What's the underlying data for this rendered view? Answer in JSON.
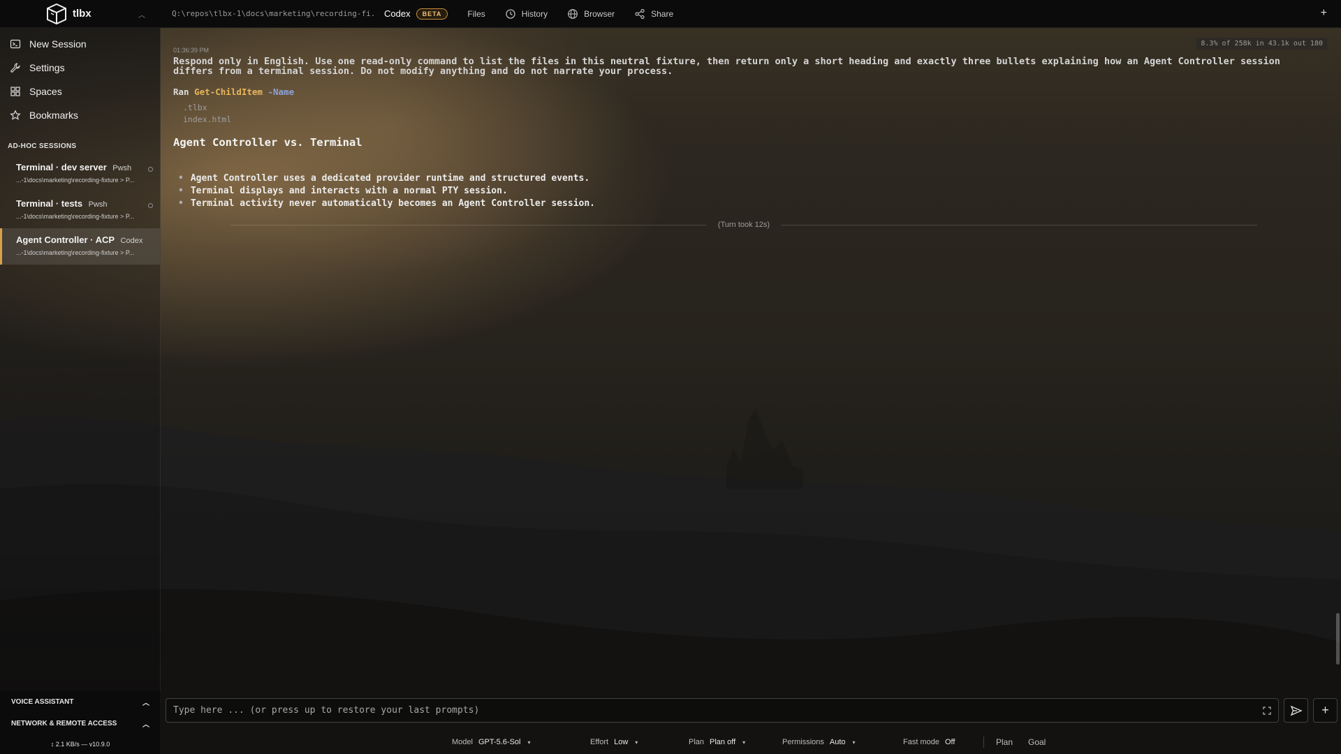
{
  "app": {
    "name": "tlbx",
    "path": "Q:\\repos\\tlbx-1\\docs\\marketing\\recording-fi..."
  },
  "tabs": [
    {
      "label": "Codex",
      "badge": "BETA"
    },
    {
      "label": "Files"
    },
    {
      "label": "History",
      "icon": "history-icon"
    },
    {
      "label": "Browser",
      "icon": "globe-icon"
    },
    {
      "label": "Share",
      "icon": "share-icon"
    }
  ],
  "topbar": {
    "plus": "+"
  },
  "sidebar": {
    "nav": [
      {
        "label": "New Session",
        "icon": "terminal-icon"
      },
      {
        "label": "Settings",
        "icon": "wrench-icon"
      },
      {
        "label": "Spaces",
        "icon": "grid-icon"
      },
      {
        "label": "Bookmarks",
        "icon": "star-icon"
      }
    ],
    "section_title": "AD-HOC SESSIONS",
    "sessions": [
      {
        "title": "Terminal · dev server",
        "tag": "Pwsh",
        "path": "...-1\\docs\\marketing\\recording-fixture > P..."
      },
      {
        "title": "Terminal · tests",
        "tag": "Pwsh",
        "path": "...-1\\docs\\marketing\\recording-fixture > P..."
      },
      {
        "title": "Agent Controller · ACP",
        "tag": "Codex",
        "path": "...-1\\docs\\marketing\\recording-fixture > P..."
      }
    ],
    "voice_assistant": "VOICE ASSISTANT",
    "network": "NETWORK & REMOTE ACCESS",
    "status": "↕ 2.1 KB/s  —  v10.9.0"
  },
  "conversation": {
    "usage": "8.3% of 258k in 43.1k out 180",
    "timestamp": "01:36:39 PM",
    "prompt": "Respond only in English. Use one read-only command to list the files in this neutral fixture, then return only a short heading and exactly three bullets explaining how an Agent Controller session differs from a terminal session. Do not modify anything and do not narrate your process.",
    "ran_label": "Ran",
    "ran_cmd": "Get-ChildItem",
    "ran_arg": "-Name",
    "output": [
      ".tlbx",
      "index.html"
    ],
    "heading": "Agent Controller vs. Terminal",
    "bullets": [
      "Agent Controller uses a dedicated provider runtime and structured events.",
      "Terminal displays and interacts with a normal PTY session.",
      "Terminal activity never automatically becomes an Agent Controller session."
    ],
    "turn": "(Turn took 12s)"
  },
  "composer": {
    "placeholder": "Type here ... (or press up to restore your last prompts)",
    "value": ""
  },
  "statusbar": {
    "model_label": "Model",
    "model": "GPT-5.6-Sol",
    "effort_label": "Effort",
    "effort": "Low",
    "plan_label": "Plan",
    "plan": "Plan off",
    "permissions_label": "Permissions",
    "permissions": "Auto",
    "fast_label": "Fast mode",
    "fast": "Off",
    "plan_btn": "Plan",
    "goal_btn": "Goal"
  },
  "colors": {
    "accent": "#d9a04a",
    "command": "#e8b65a",
    "argument": "#8fa3d6"
  }
}
